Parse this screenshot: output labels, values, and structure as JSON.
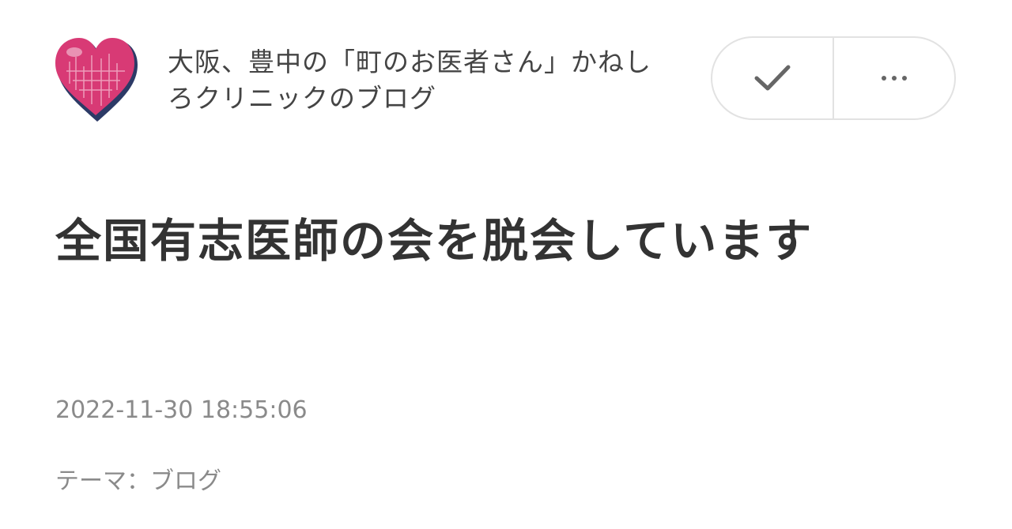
{
  "blog": {
    "title": "大阪、豊中の「町のお医者さん」かねしろクリニックのブログ",
    "logo_icon": "heart-logo-icon"
  },
  "actions": {
    "follow_icon": "checkmark-icon",
    "more_icon": "more-dots-icon"
  },
  "article": {
    "title": "全国有志医師の会を脱会しています",
    "date": "2022-11-30 18:55:06",
    "theme_label": "テーマ：",
    "theme_value": "ブログ"
  },
  "colors": {
    "logo_pink": "#d83a75",
    "logo_navy": "#2c3a66",
    "text_dark": "#333333",
    "text_muted": "#8a8a8a",
    "border": "#e2e2e2"
  }
}
